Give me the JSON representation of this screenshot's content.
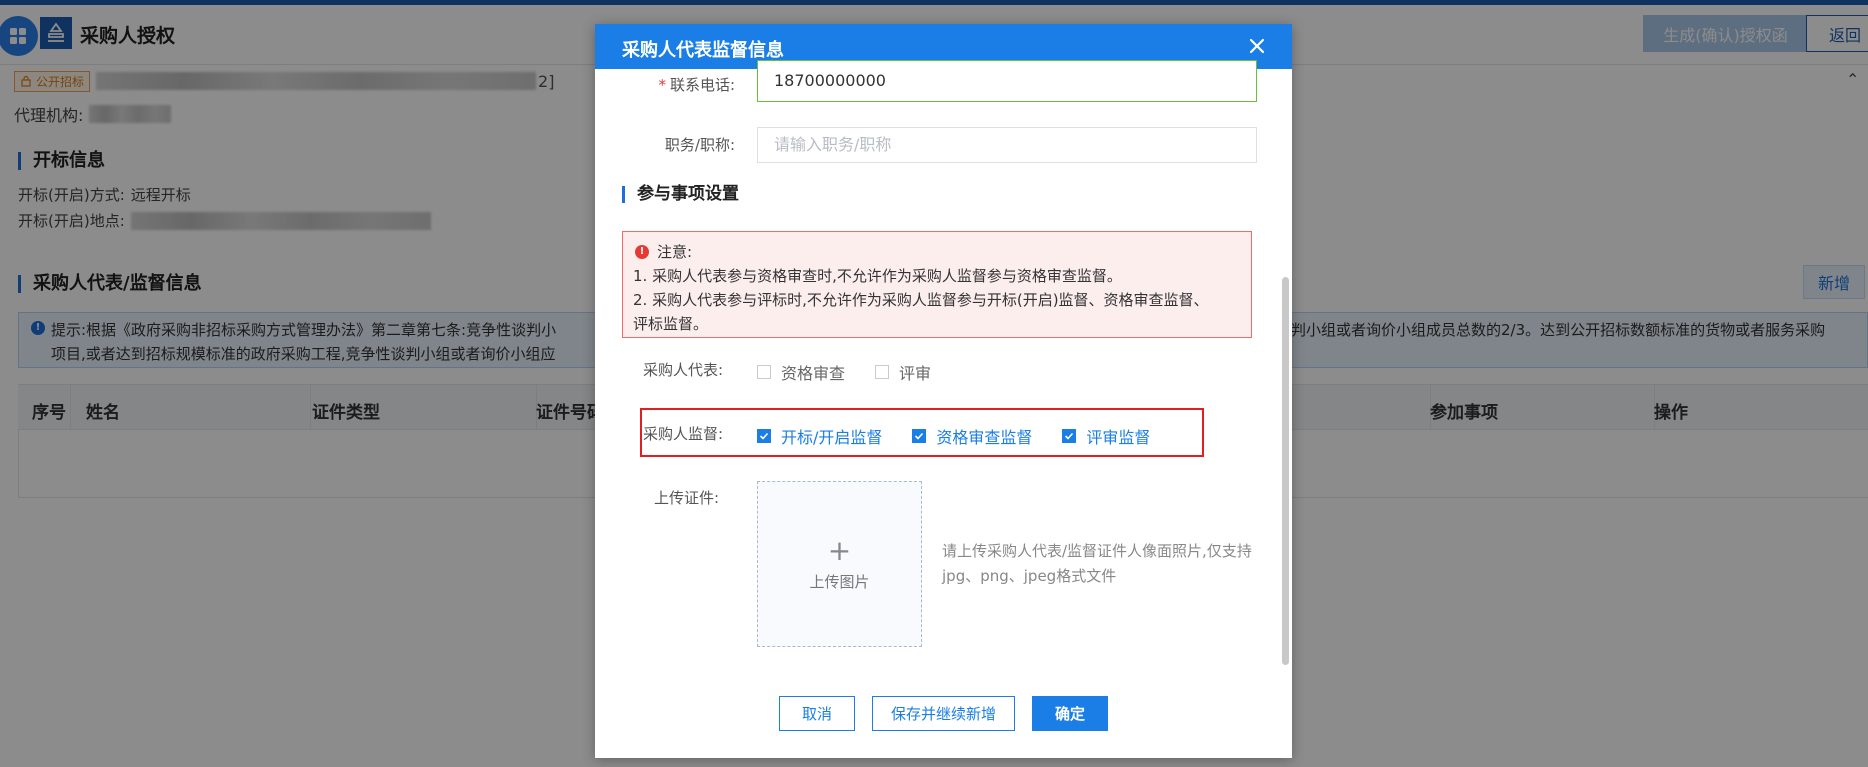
{
  "header": {
    "title": "采购人授权",
    "generate_label": "生成(确认)授权函",
    "back_label": "返回"
  },
  "project": {
    "tag_label": "公开招标",
    "tag_suffix": "2]",
    "agency_label": "代理机构:"
  },
  "opening": {
    "section_title": "开标信息",
    "method_label": "开标(开启)方式:",
    "method_value": "远程开标",
    "location_label": "开标(开启)地点:"
  },
  "reps": {
    "section_title": "采购人代表/监督信息",
    "add_label": "新增",
    "notice_line1_left": "提示:根据《政府采购非招标采购方式管理办法》第二章第七条:竞争性谈判小",
    "notice_line1_right": "判小组或者询价小组成员总数的2/3。达到公开招标数额标准的货物或者服务采购",
    "notice_line2_left": "项目,或者达到招标规模标准的政府采购工程,竞争性谈判小组或者询价小组应",
    "columns": [
      "序号",
      "姓名",
      "证件类型",
      "证件号码",
      "参加事项",
      "操作"
    ]
  },
  "modal": {
    "title": "采购人代表监督信息",
    "phone_label": "联系电话:",
    "phone_value": "18700000000",
    "job_label": "职务/职称:",
    "job_placeholder": "请输入职务/职称",
    "participation_title": "参与事项设置",
    "warning": {
      "head": "注意:",
      "line1": "1. 采购人代表参与资格审查时,不允许作为采购人监督参与资格审查监督。",
      "line2": "2. 采购人代表参与评标时,不允许作为采购人监督参与开标(开启)监督、资格审查监督、",
      "line3": "评标监督。"
    },
    "rep_label": "采购人代表:",
    "rep_options": [
      {
        "label": "资格审查",
        "checked": false
      },
      {
        "label": "评审",
        "checked": false
      }
    ],
    "sup_label": "采购人监督:",
    "sup_options": [
      {
        "label": "开标/开启监督",
        "checked": true
      },
      {
        "label": "资格审查监督",
        "checked": true
      },
      {
        "label": "评审监督",
        "checked": true
      }
    ],
    "upload_label": "上传证件:",
    "upload_button": "上传图片",
    "upload_hint": "请上传采购人代表/监督证件人像面照片,仅支持jpg、png、jpeg格式文件",
    "cancel_label": "取消",
    "save_continue_label": "保存并继续新增",
    "confirm_label": "确定"
  },
  "colors": {
    "primary": "#1a7ee6",
    "warning_border": "#f36a6a",
    "highlight": "#e02020"
  }
}
